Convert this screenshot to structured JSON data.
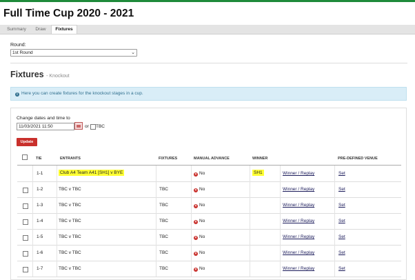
{
  "page": {
    "title": "Full Time Cup 2020 - 2021"
  },
  "tabs": [
    {
      "label": "Summary"
    },
    {
      "label": "Draw"
    },
    {
      "label": "Fixtures"
    }
  ],
  "round": {
    "label": "Round:",
    "selected": "1st Round"
  },
  "fixtures": {
    "heading": "Fixtures",
    "subheading": "- Knockout"
  },
  "info": {
    "text": "Here you can create fixtures for the knockout stages in a cup."
  },
  "dates": {
    "label": "Change dates and time to",
    "value": "11/03/2021 11:50",
    "or": "or",
    "tbc": "TBC"
  },
  "update_label": "Update",
  "table": {
    "headers": {
      "tie": "TIE",
      "entrants": "ENTRANTS",
      "fixtures": "FIXTURES",
      "manual": "MANUAL ADVANCE",
      "winner": "WINNER",
      "venue": "PRE-DEFINED VENUE"
    },
    "rows": [
      {
        "tie": "1-1",
        "entrants": "Club A4 Team A41 [SH1] v BYE",
        "fixture": "",
        "manual": "No",
        "winner": "SH1",
        "action": "Winner / Replay",
        "venue": "Set"
      },
      {
        "tie": "1-2",
        "entrants": "TBC v TBC",
        "fixture": "TBC",
        "manual": "No",
        "winner": "",
        "action": "Winner / Replay",
        "venue": "Set"
      },
      {
        "tie": "1-3",
        "entrants": "TBC v TBC",
        "fixture": "TBC",
        "manual": "No",
        "winner": "",
        "action": "Winner / Replay",
        "venue": "Set"
      },
      {
        "tie": "1-4",
        "entrants": "TBC v TBC",
        "fixture": "TBC",
        "manual": "No",
        "winner": "",
        "action": "Winner / Replay",
        "venue": "Set"
      },
      {
        "tie": "1-5",
        "entrants": "TBC v TBC",
        "fixture": "TBC",
        "manual": "No",
        "winner": "",
        "action": "Winner / Replay",
        "venue": "Set"
      },
      {
        "tie": "1-6",
        "entrants": "TBC v TBC",
        "fixture": "TBC",
        "manual": "No",
        "winner": "",
        "action": "Winner / Replay",
        "venue": "Set"
      },
      {
        "tie": "1-7",
        "entrants": "TBC v TBC",
        "fixture": "TBC",
        "manual": "No",
        "winner": "",
        "action": "Winner / Replay",
        "venue": "Set"
      }
    ]
  }
}
